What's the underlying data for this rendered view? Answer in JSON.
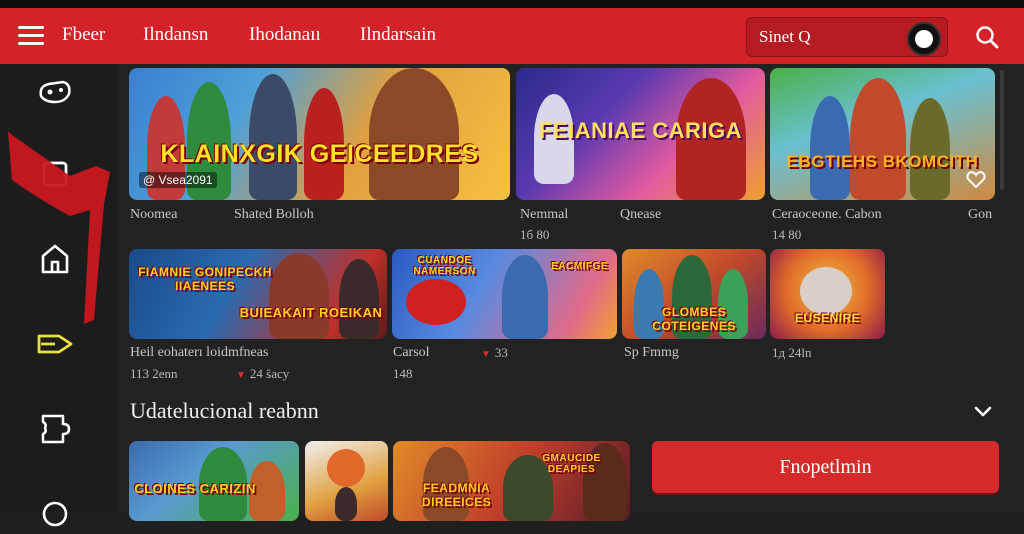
{
  "header": {
    "nav": [
      "Fbeer",
      "Ilndansn",
      "Ihodanaıı",
      "Ilndarsain"
    ],
    "search_text": "Sinet Q",
    "accent_color": "#d32228"
  },
  "sidebar": {
    "icons": [
      "gamepad-icon",
      "square-icon",
      "home-icon",
      "tag-icon",
      "puzzle-icon",
      "profile-icon"
    ]
  },
  "row1": [
    {
      "title": "KLAINXGIK GEICEEDRES",
      "badge": "@ Vsea2091",
      "name": "Noomea",
      "meta2": "",
      "extra_name": "Shated Bolloh"
    },
    {
      "title": "FEIANIAE CARIGA",
      "name": "Nemmal",
      "meta2": "1б 80",
      "extra_name": "Qnease"
    },
    {
      "title": "EBGTIEHS BKOMCITH",
      "name": "Ceraoceone. Cabon",
      "meta2": "14 80",
      "extra_name": "Gon"
    }
  ],
  "row2": [
    {
      "title": "FIAMNIE GONIPECKH IIAENEES",
      "sub": "BUIEAKAIT ROEIKAN",
      "name": "Heil eohaterı loidmfneas",
      "meta2": "113 2enn",
      "meta3": "24 ŝacy"
    },
    {
      "title": "CUANDOE NAMERSON",
      "sub": "EACMIFGE",
      "name": "Carsol",
      "meta2": "33",
      "meta3": "148"
    },
    {
      "title": "GLOMBES COTEIGENES",
      "name": "Sp Fmmg",
      "meta2": ""
    },
    {
      "title": "EUSENIRE",
      "name": "",
      "meta2": "1д 24ln"
    }
  ],
  "section": {
    "title": "Udatelucional reabnn"
  },
  "row3": [
    {
      "title": "CLOINES CARIZIN"
    },
    {
      "title": ""
    },
    {
      "title": "FEADMNIA DIREEICES",
      "sub": "GMAUCIDE DEAPIES"
    }
  ],
  "cta_label": "Fnopetlmin"
}
